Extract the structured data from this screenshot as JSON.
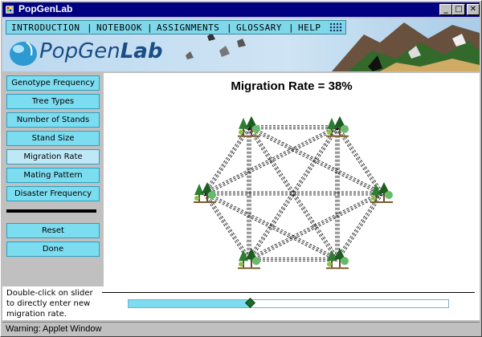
{
  "window": {
    "title": "PopGenLab",
    "buttons": {
      "minimize": "_",
      "maximize": "□",
      "close": "✕"
    }
  },
  "header": {
    "menu": [
      "INTRODUCTION",
      "NOTEBOOK",
      "ASSIGNMENTS",
      "GLOSSARY",
      "HELP"
    ],
    "menu_separator": "|",
    "logo_text_regular": "PopGen",
    "logo_text_bold": "Lab"
  },
  "sidebar": {
    "buttons": [
      {
        "label": "Genotype Frequency",
        "active": false
      },
      {
        "label": "Tree Types",
        "active": false
      },
      {
        "label": "Number of Stands",
        "active": false
      },
      {
        "label": "Stand Size",
        "active": false
      },
      {
        "label": "Migration Rate",
        "active": true
      },
      {
        "label": "Mating Pattern",
        "active": false
      },
      {
        "label": "Disaster Frequency",
        "active": false
      }
    ],
    "actions": [
      {
        "label": "Reset"
      },
      {
        "label": "Done"
      }
    ]
  },
  "main": {
    "title": "Migration Rate = 38%",
    "stand_count": 6
  },
  "slider": {
    "hint": "Double-click on slider to directly enter new migration rate.",
    "value_fraction": 0.38
  },
  "status": {
    "text": "Warning: Applet Window"
  },
  "colors": {
    "title_bar": "#000080",
    "button_fill": "#7cdcf0",
    "active_button_fill": "#bfe8f7",
    "tree_green": "#2e7d32"
  }
}
